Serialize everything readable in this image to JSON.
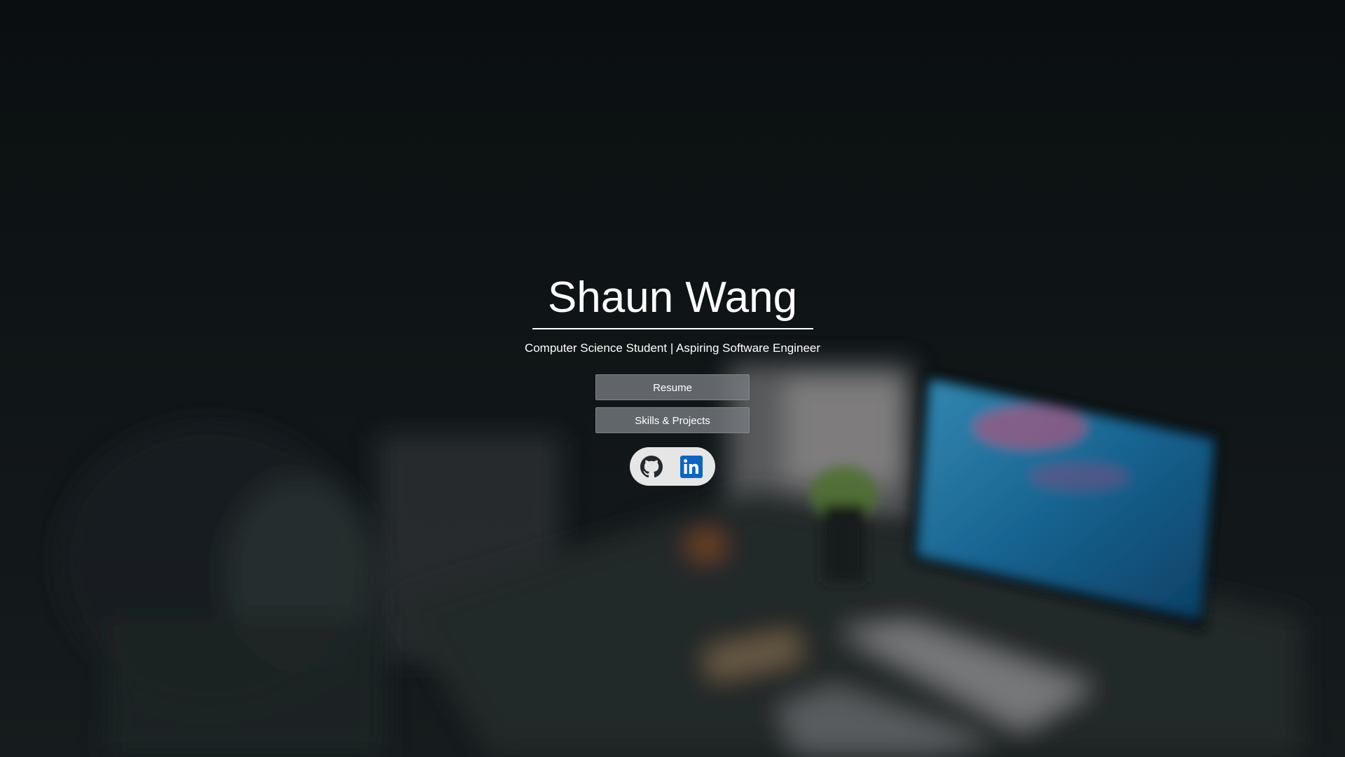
{
  "hero": {
    "name": "Shaun Wang",
    "tagline": "Computer Science Student | Aspiring Software Engineer"
  },
  "buttons": {
    "resume_label": "Resume",
    "skills_label": "Skills & Projects"
  },
  "social": {
    "icons": [
      "github-icon",
      "linkedin-icon"
    ],
    "linkedin_text": "in"
  },
  "colors": {
    "text": "#ffffff",
    "button_bg": "#7a7e84",
    "social_pill_bg": "#e6e6e6",
    "linkedin_blue": "#0a66c2",
    "github_dark": "#24292f"
  }
}
